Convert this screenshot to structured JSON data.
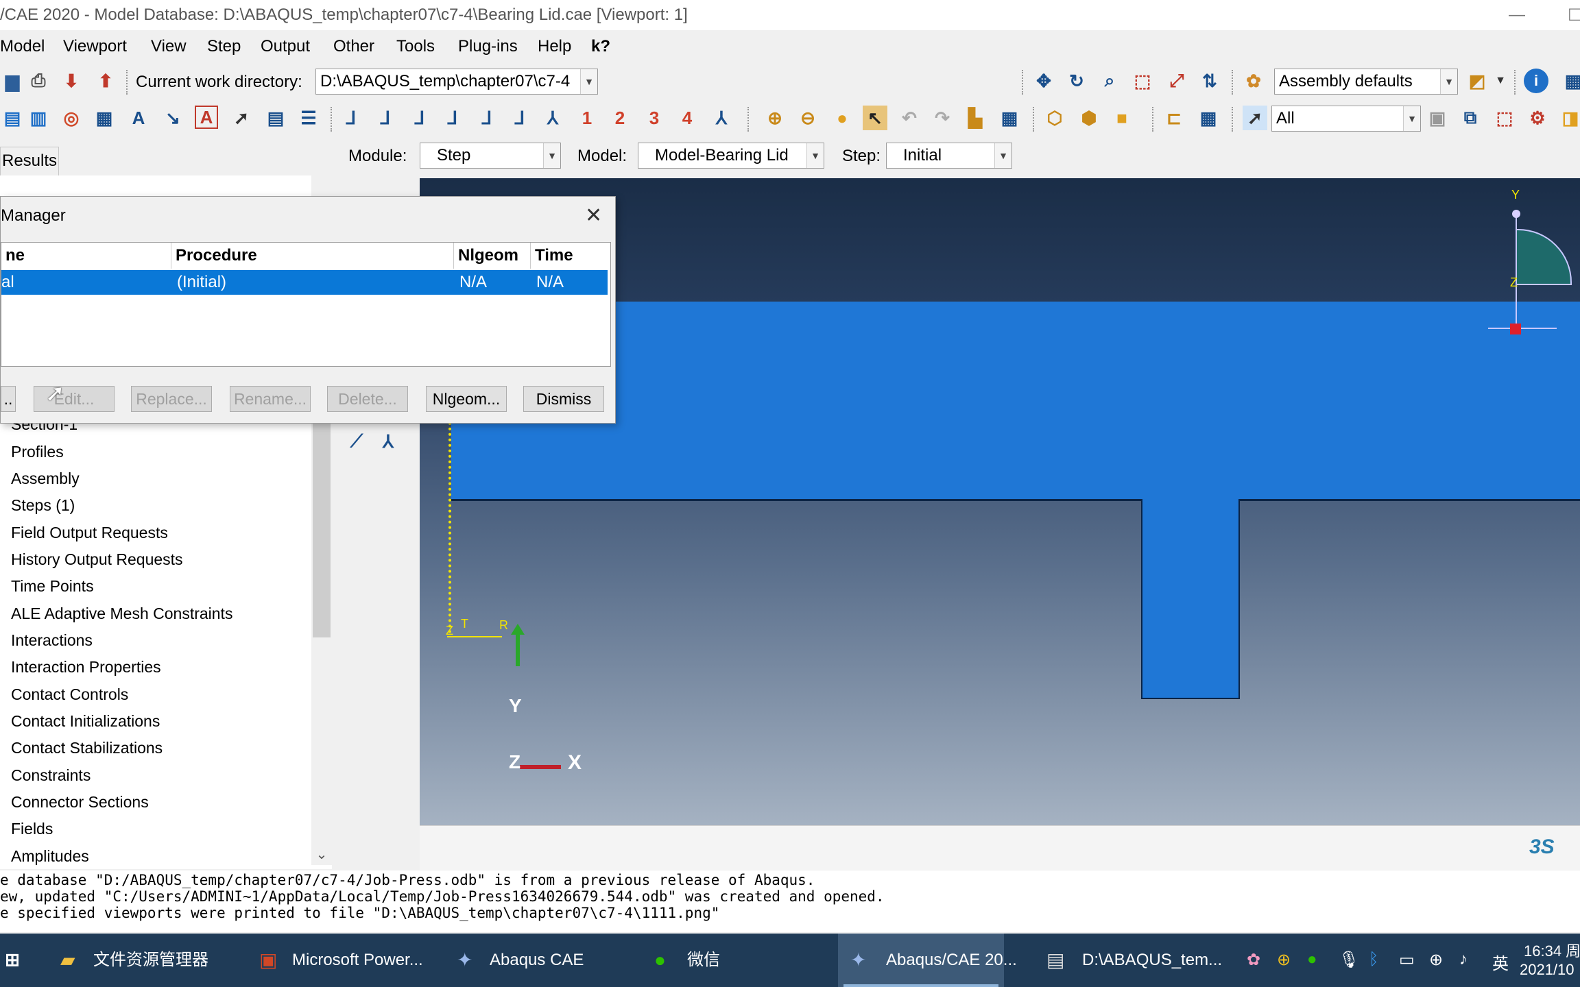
{
  "window": {
    "title": "/CAE 2020 - Model Database: D:\\ABAQUS_temp\\chapter07\\c7-4\\Bearing Lid.cae [Viewport: 1]"
  },
  "menu": [
    "Model",
    "Viewport",
    "View",
    "Step",
    "Output",
    "Other",
    "Tools",
    "Plug-ins",
    "Help",
    "k?"
  ],
  "toolbar": {
    "cwd_label": "Current work directory:",
    "cwd_value": "D:\\ABAQUS_temp\\chapter07\\c7-4",
    "render_style": "Assembly defaults",
    "selection_filter": "All",
    "num_buttons": [
      "1",
      "2",
      "3",
      "4"
    ]
  },
  "context": {
    "module_label": "Module:",
    "module_value": "Step",
    "model_label": "Model:",
    "model_value": "Model-Bearing Lid",
    "step_label": "Step:",
    "step_value": "Initial"
  },
  "left_panel": {
    "results_tab": "Results",
    "tree": [
      "Section-1",
      "Profiles",
      "Assembly",
      "Steps (1)",
      "Field Output Requests",
      "History Output Requests",
      "Time Points",
      "ALE Adaptive Mesh Constraints",
      "Interactions",
      "Interaction Properties",
      "Contact Controls",
      "Contact Initializations",
      "Contact Stabilizations",
      "Constraints",
      "Connector Sections",
      "Fields",
      "Amplitudes"
    ]
  },
  "dialog": {
    "title": "Manager",
    "columns": [
      "ne",
      "Procedure",
      "Nlgeom",
      "Time"
    ],
    "rows": [
      {
        "name": "al",
        "procedure": "(Initial)",
        "nlgeom": "N/A",
        "time": "N/A",
        "selected": true
      }
    ],
    "buttons": [
      {
        "label": "..",
        "enabled": true
      },
      {
        "label": "Edit...",
        "enabled": false
      },
      {
        "label": "Replace...",
        "enabled": false
      },
      {
        "label": "Rename...",
        "enabled": false
      },
      {
        "label": "Delete...",
        "enabled": false
      },
      {
        "label": "Nlgeom...",
        "enabled": true
      },
      {
        "label": "Dismiss",
        "enabled": true
      }
    ]
  },
  "viewport": {
    "triad_x": "X",
    "triad_y": "Y",
    "triad_z": "Z",
    "csys_z": "Z",
    "csys_t": "T",
    "csys_r": "R",
    "mini_y": "Y",
    "mini_z": "Z",
    "logo": "3S",
    "part_color": "#1f77d6",
    "background_top": "#1a2d47",
    "background_bottom": "#a5b2c2"
  },
  "messages": [
    "e database \"D:/ABAQUS_temp/chapter07/c7-4/Job-Press.odb\" is from a previous release of Abaqus.",
    "ew, updated \"C:/Users/ADMINI~1/AppData/Local/Temp/Job-Press1634026679.544.odb\" was created and opened.",
    "e specified viewports were printed to file \"D:\\ABAQUS_temp\\chapter07\\c7-4\\1111.png\""
  ],
  "taskbar": {
    "items": [
      {
        "label": "文件资源管理器",
        "active": false
      },
      {
        "label": "Microsoft Power...",
        "active": false
      },
      {
        "label": "Abaqus CAE",
        "active": false
      },
      {
        "label": "微信",
        "active": false
      },
      {
        "label": "Abaqus/CAE 20...",
        "active": true
      },
      {
        "label": "D:\\ABAQUS_tem...",
        "active": false
      }
    ],
    "ime": "英",
    "time": "16:34 周",
    "date": "2021/10"
  }
}
